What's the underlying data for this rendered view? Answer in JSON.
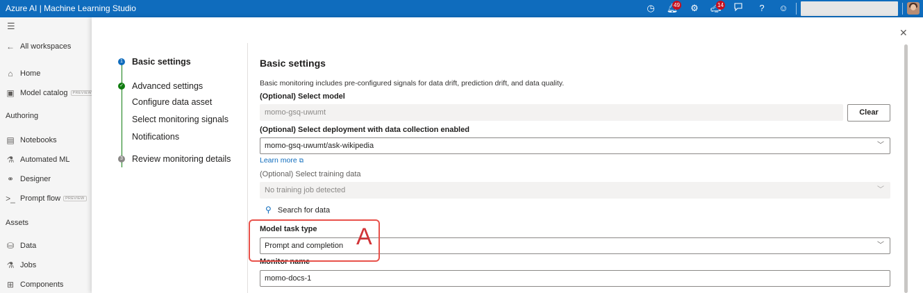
{
  "app": {
    "title": "Azure AI | Machine Learning Studio"
  },
  "topbar": {
    "icons": [
      {
        "name": "clock-icon"
      },
      {
        "name": "bell-icon",
        "badge": "49"
      },
      {
        "name": "gear-icon"
      },
      {
        "name": "megaphone-icon",
        "badge": "14"
      },
      {
        "name": "feedback-icon"
      },
      {
        "name": "help-icon"
      },
      {
        "name": "smiley-icon"
      }
    ]
  },
  "nav": {
    "all_workspaces": "All workspaces",
    "home": "Home",
    "model_catalog": "Model catalog",
    "preview_tag": "PREVIEW",
    "section_authoring": "Authoring",
    "notebooks": "Notebooks",
    "automated_ml": "Automated ML",
    "designer": "Designer",
    "prompt_flow": "Prompt flow",
    "section_assets": "Assets",
    "data": "Data",
    "jobs": "Jobs",
    "components": "Components"
  },
  "steps": [
    {
      "label": "Basic settings",
      "state": "current",
      "marker": "1"
    },
    {
      "label": "Advanced settings",
      "state": "done",
      "marker": "✓"
    },
    {
      "label": "Configure data asset",
      "state": "sub"
    },
    {
      "label": "Select monitoring signals",
      "state": "sub"
    },
    {
      "label": "Notifications",
      "state": "sub"
    },
    {
      "label": "Review monitoring details",
      "state": "pending",
      "marker": "3"
    }
  ],
  "form": {
    "title": "Basic settings",
    "description": "Basic monitoring includes pre-configured signals for data drift, prediction drift, and data quality.",
    "select_model_label": "(Optional) Select model",
    "select_model_value": "momo-gsq-uwumt",
    "clear_label": "Clear",
    "deployment_label": "(Optional) Select deployment with data collection enabled",
    "deployment_value": "momo-gsq-uwumt/ask-wikipedia",
    "learn_more": "Learn more",
    "training_label": "(Optional) Select training data",
    "training_value": "No training job detected",
    "search_for_data": "Search for data",
    "task_type_label": "Model task type",
    "task_type_value": "Prompt and completion",
    "monitor_name_label": "Monitor name",
    "monitor_name_value": "momo-docs-1"
  },
  "annotation": {
    "letter": "A",
    "color": "#d13438"
  },
  "colors": {
    "brand": "#0f6cbd",
    "success": "#107c10",
    "badge": "#c50f1f"
  }
}
